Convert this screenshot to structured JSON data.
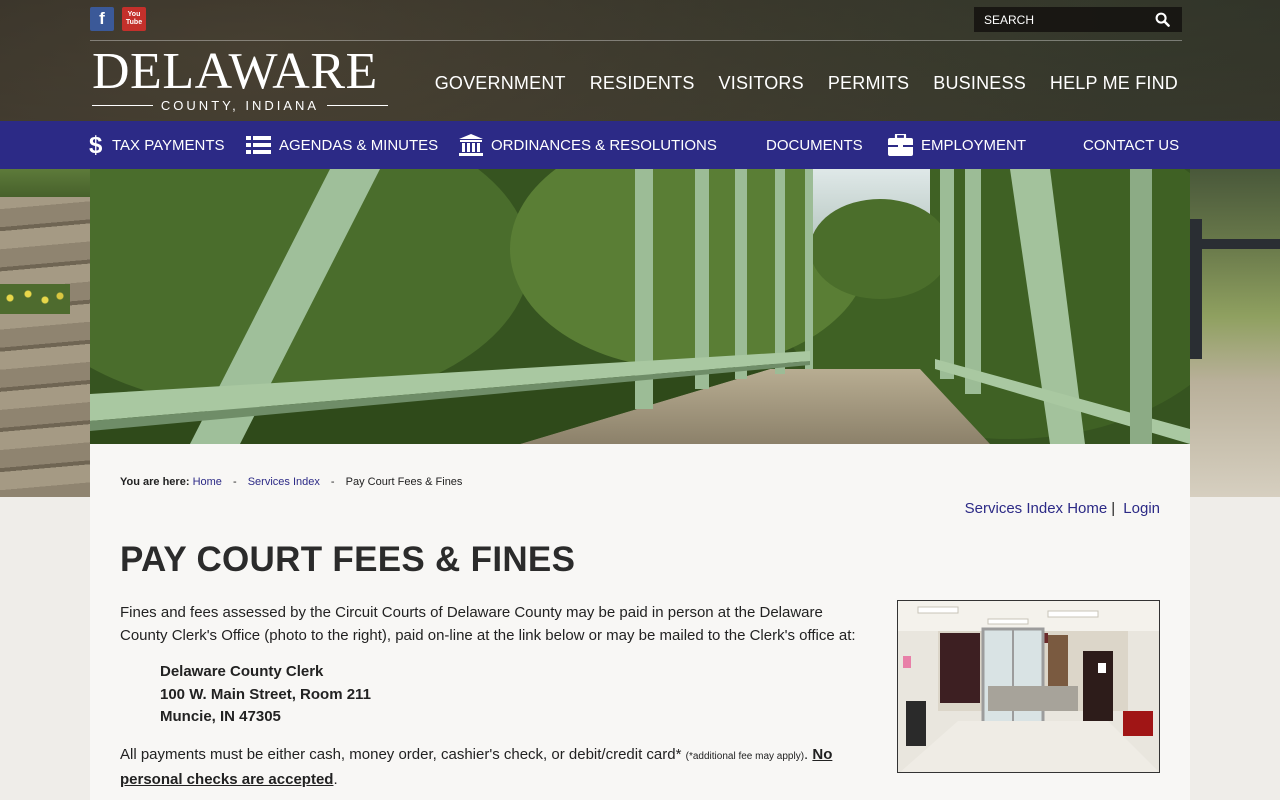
{
  "social": {
    "facebook": "f",
    "youtube_top": "You",
    "youtube_bottom": "Tube"
  },
  "search": {
    "placeholder": "SEARCH"
  },
  "logo": {
    "main": "DELAWARE",
    "sub": "COUNTY, INDIANA"
  },
  "main_nav": [
    "GOVERNMENT",
    "RESIDENTS",
    "VISITORS",
    "PERMITS",
    "BUSINESS",
    "HELP ME FIND"
  ],
  "quick_links": {
    "tax": "TAX PAYMENTS",
    "agendas": "AGENDAS & MINUTES",
    "ordinances": "ORDINANCES & RESOLUTIONS",
    "documents": "DOCUMENTS",
    "employment": "EMPLOYMENT",
    "contact": "CONTACT US"
  },
  "breadcrumb": {
    "prefix": "You are here:",
    "home": "Home",
    "services": "Services Index",
    "current": "Pay Court Fees & Fines"
  },
  "util_links": {
    "services_home": "Services Index Home",
    "login": "Login"
  },
  "page": {
    "title": "PAY COURT FEES & FINES",
    "intro": "Fines and fees assessed by the Circuit Courts of Delaware County may be paid in person at the Delaware County Clerk's Office (photo to the right), paid on-line at the link below or may be mailed to the Clerk's office at:",
    "address_line1": "Delaware County Clerk",
    "address_line2": "100 W. Main Street, Room 211",
    "address_line3": "Muncie, IN 47305",
    "payments_text": "All payments must be either cash, money order, cashier's check, or debit/credit card*",
    "payments_note": "(*additional fee may apply)",
    "payments_sep": ".",
    "no_checks": "No personal checks are accepted",
    "payments_end": "."
  },
  "colors": {
    "purple_bar": "#2c2a86",
    "link": "#2c2a86",
    "facebook": "#3b5998",
    "youtube": "#c4302b"
  }
}
